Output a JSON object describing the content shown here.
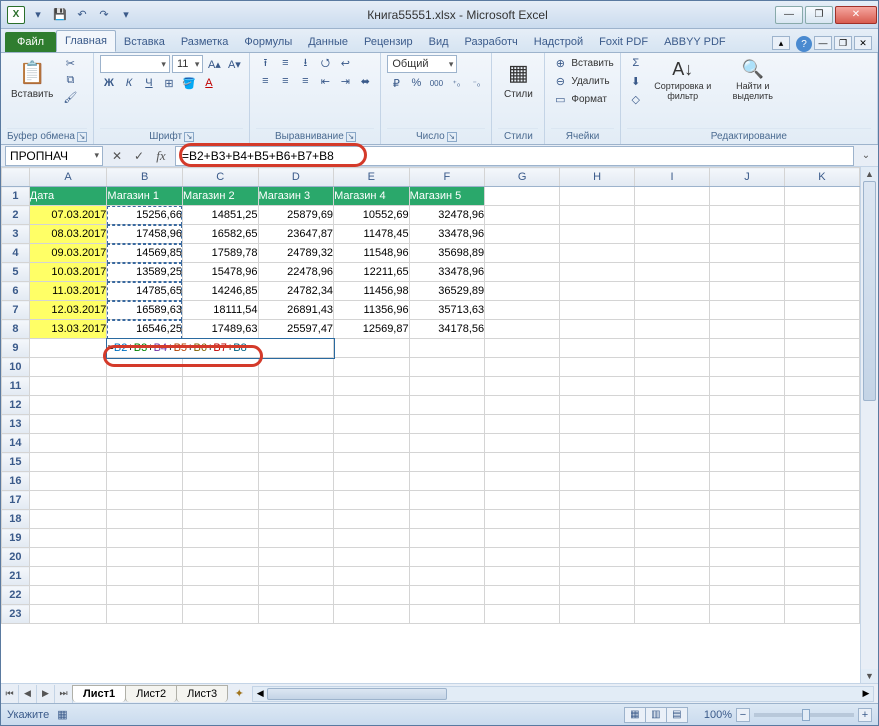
{
  "app": {
    "title": "Книга55551.xlsx - Microsoft Excel",
    "excel_letter": "X"
  },
  "qat": {
    "save": "💾",
    "undo": "↶",
    "redo": "↷",
    "dropdown": "▾"
  },
  "win": {
    "min": "—",
    "max": "❐",
    "close": "✕"
  },
  "tabs": {
    "file": "Файл",
    "items": [
      {
        "label": "Главная",
        "active": true
      },
      {
        "label": "Вставка"
      },
      {
        "label": "Разметка"
      },
      {
        "label": "Формулы"
      },
      {
        "label": "Данные"
      },
      {
        "label": "Рецензир"
      },
      {
        "label": "Вид"
      },
      {
        "label": "Разработч"
      },
      {
        "label": "Надстрой"
      },
      {
        "label": "Foxit PDF"
      },
      {
        "label": "ABBYY PDF"
      }
    ],
    "help": "?"
  },
  "mdi": {
    "min": "—",
    "max": "❐",
    "close": "✕",
    "up": "▴"
  },
  "ribbon": {
    "clipboard": {
      "label": "Буфер обмена",
      "paste": "Вставить",
      "paste_icon": "📋",
      "cut": "✂",
      "copy": "⧉",
      "painter": "🖌"
    },
    "font": {
      "label": "Шрифт",
      "size": "11",
      "bold": "Ж",
      "italic": "К",
      "underline": "Ч",
      "border": "⊞",
      "fill": "🪣",
      "color": "A",
      "grow": "A▴",
      "shrink": "A▾"
    },
    "align": {
      "label": "Выравнивание",
      "top": "⭱",
      "mid": "≡",
      "bot": "⭳",
      "left": "≡",
      "center": "≡",
      "right": "≡",
      "indent_dec": "⇤",
      "indent_inc": "⇥",
      "wrap": "↩",
      "merge": "⬌",
      "orient": "⭯"
    },
    "number": {
      "label": "Число",
      "format": "Общий",
      "currency": "₽",
      "percent": "%",
      "comma": "000",
      "inc_dec": "⁺₀",
      "dec_dec": "⁻₀"
    },
    "styles": {
      "label": "Стили",
      "btn": "Стили",
      "cond": "▦",
      "table": "▦",
      "cell": "▦"
    },
    "cells": {
      "label": "Ячейки",
      "insert": "Вставить",
      "delete": "Удалить",
      "format": "Формат",
      "ins_icon": "⊕",
      "del_icon": "⊖",
      "fmt_icon": "▭"
    },
    "editing": {
      "label": "Редактирование",
      "sort": "Сортировка и фильтр",
      "find": "Найти и выделить",
      "sum": "Σ",
      "fill": "⬇",
      "clear": "◇",
      "sort_icon": "A↓",
      "find_icon": "🔍"
    }
  },
  "formula_bar": {
    "namebox": "ПРОПНАЧ",
    "cancel": "✕",
    "enter": "✓",
    "fx": "fx",
    "formula": "=B2+B3+B4+B5+B6+B7+B8",
    "expand": "⌄"
  },
  "grid": {
    "cols": [
      "A",
      "B",
      "C",
      "D",
      "E",
      "F",
      "G",
      "H",
      "I",
      "J",
      "K"
    ],
    "row_numbers": [
      1,
      2,
      3,
      4,
      5,
      6,
      7,
      8,
      9,
      10,
      11,
      12,
      13,
      14,
      15,
      16,
      17,
      18,
      19,
      20,
      21,
      22,
      23
    ],
    "headers": [
      "Дата",
      "Магазин 1",
      "Магазин 2",
      "Магазин 3",
      "Магазин 4",
      "Магазин 5"
    ],
    "rows": [
      {
        "date": "07.03.2017",
        "v": [
          "15256,66",
          "14851,25",
          "25879,69",
          "10552,69",
          "32478,96"
        ]
      },
      {
        "date": "08.03.2017",
        "v": [
          "17458,96",
          "16582,65",
          "23647,87",
          "11478,45",
          "33478,96"
        ]
      },
      {
        "date": "09.03.2017",
        "v": [
          "14569,85",
          "17589,78",
          "24789,32",
          "11548,96",
          "35698,89"
        ]
      },
      {
        "date": "10.03.2017",
        "v": [
          "13589,25",
          "15478,96",
          "22478,96",
          "12211,65",
          "33478,96"
        ]
      },
      {
        "date": "11.03.2017",
        "v": [
          "14785,65",
          "14246,85",
          "24782,34",
          "11456,98",
          "36529,89"
        ]
      },
      {
        "date": "12.03.2017",
        "v": [
          "16589,63",
          "18111,54",
          "26891,43",
          "11356,96",
          "35713,63"
        ]
      },
      {
        "date": "13.03.2017",
        "v": [
          "16546,25",
          "17489,63",
          "25597,47",
          "12569,87",
          "34178,56"
        ]
      }
    ],
    "edit_formula_parts": [
      "=",
      "B2",
      "+",
      "B3",
      "+",
      "B4",
      "+",
      "B5",
      "+",
      "B6",
      "+",
      "B7",
      "+",
      "B8"
    ]
  },
  "sheet_tabs": {
    "nav": {
      "first": "⏮",
      "prev": "◀",
      "next": "▶",
      "last": "⏭"
    },
    "items": [
      {
        "label": "Лист1",
        "active": true
      },
      {
        "label": "Лист2"
      },
      {
        "label": "Лист3"
      }
    ],
    "insert": "✦"
  },
  "status": {
    "mode": "Укажите",
    "macro": "▦",
    "views": {
      "normal": "▦",
      "layout": "▥",
      "pbreak": "▤"
    },
    "zoom_pct": "100%",
    "minus": "−",
    "plus": "+"
  }
}
